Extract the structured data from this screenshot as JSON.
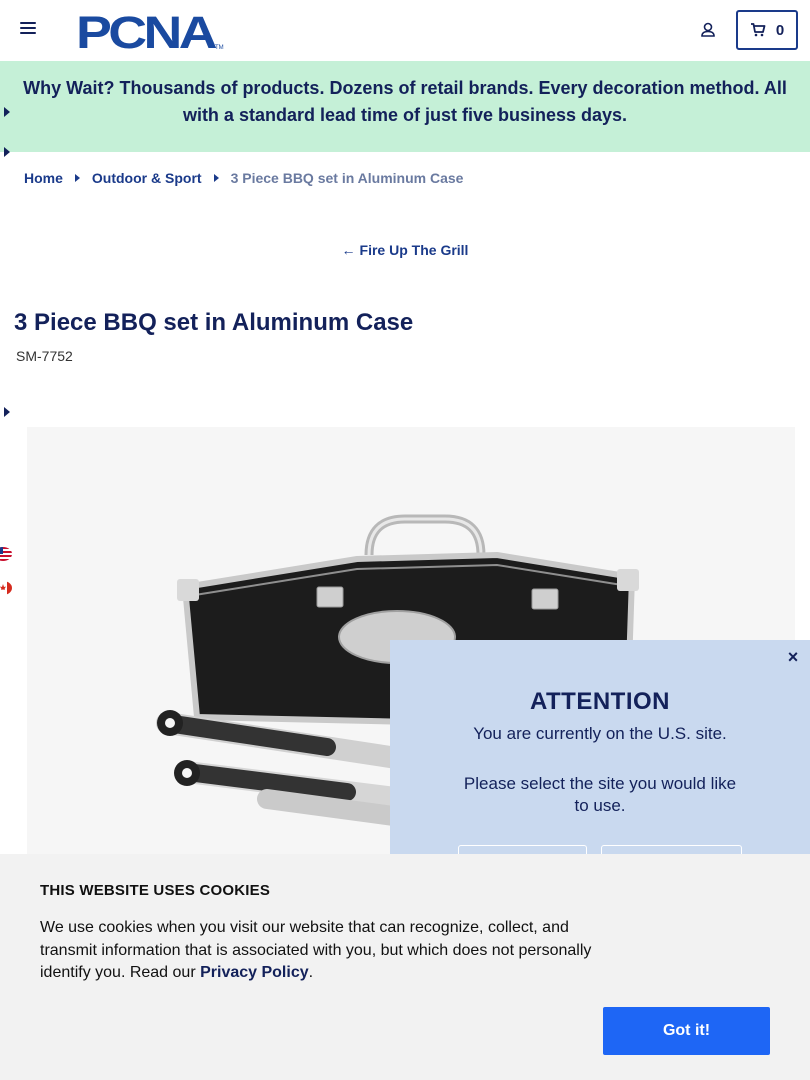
{
  "header": {
    "logo_text": "PCNA",
    "cart_count": "0"
  },
  "promo": {
    "text": "Why Wait? Thousands of products. Dozens of retail brands. Every decoration method. All with a standard lead time of just five business days."
  },
  "breadcrumb": {
    "home": "Home",
    "category": "Outdoor & Sport",
    "current": "3 Piece BBQ set in Aluminum Case"
  },
  "back_link": {
    "label": "Fire Up The Grill"
  },
  "product": {
    "title": "3 Piece BBQ set in Aluminum Case",
    "sku": "SM-7752"
  },
  "attention": {
    "close_label": "×",
    "title": "ATTENTION",
    "line1": "You are currently on the U.S. site.",
    "line2": "Please select the site you would like to use."
  },
  "cookie": {
    "title": "THIS WEBSITE USES COOKIES",
    "text": "We use cookies when you visit our website that can recognize, collect, and transmit information that is associated with you, but which does not personally identify you. Read our ",
    "link": "Privacy Policy",
    "after_link": ".",
    "button": "Got it!"
  },
  "colors": {
    "navy": "#13215a",
    "promo_bg": "#c5f0d7",
    "modal_bg": "#c9d9ef",
    "button_blue": "#1e66f5"
  }
}
